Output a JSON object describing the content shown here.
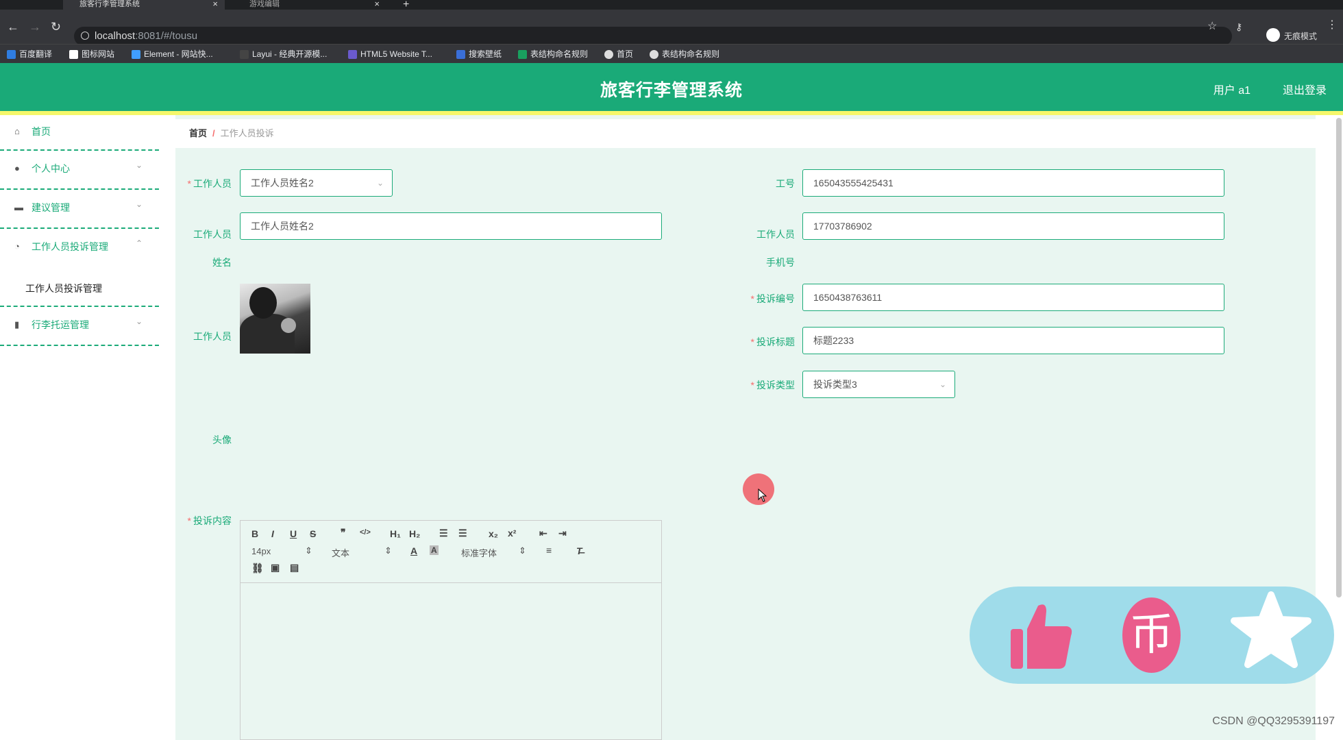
{
  "browser": {
    "tabs": [
      {
        "title": "旅客行李管理系统",
        "active": true
      },
      {
        "title": "游戏编辑",
        "active": false
      }
    ],
    "url_host": "localhost",
    "url_rest": ":8081/#/tousu",
    "profile_label": "无痕模式",
    "bookmarks": [
      "百度翻译",
      "图标网站",
      "Element - 网站快...",
      "Layui - 经典开源模...",
      "HTML5 Website T...",
      "搜索壁纸",
      "表结构命名规则",
      "首页",
      "表结构命名规则"
    ]
  },
  "header": {
    "title": "旅客行李管理系统",
    "user": "用户 a1",
    "logout": "退出登录"
  },
  "sidebar": {
    "items": [
      {
        "label": "首页",
        "icon": "home-icon"
      },
      {
        "label": "个人中心",
        "icon": "user-icon"
      },
      {
        "label": "建议管理",
        "icon": "ticket-icon"
      },
      {
        "label": "工作人员投诉管理",
        "icon": "compass-icon",
        "expanded": true
      },
      {
        "label": "行李托运管理",
        "icon": "bars-icon"
      }
    ],
    "submenu": "工作人员投诉管理"
  },
  "breadcrumb": {
    "home": "首页",
    "separator": "/",
    "current": "工作人员投诉"
  },
  "form": {
    "staff_label": "工作人员",
    "staff_value": "工作人员姓名2",
    "job_no_label": "工号",
    "job_no_value": "165043555425431",
    "staff_name_label_1": "工作人员",
    "staff_name_label_2": "姓名",
    "staff_name_value": "工作人员姓名2",
    "staff_phone_label_1": "工作人员",
    "staff_phone_label_2": "手机号",
    "staff_phone_value": "17703786902",
    "avatar_label_1": "工作人员",
    "avatar_label_2": "头像",
    "complaint_no_label": "投诉编号",
    "complaint_no_value": "1650438763611",
    "complaint_title_label": "投诉标题",
    "complaint_title_value": "标题2233",
    "complaint_type_label": "投诉类型",
    "complaint_type_value": "投诉类型3",
    "content_label": "投诉内容",
    "editor": {
      "font_size": "14px",
      "block_format": "文本",
      "font_family": "标准字体"
    }
  },
  "watermark": "CSDN @QQ3295391197",
  "colors": {
    "primary": "#1aaa78",
    "required": "#f56c6c",
    "header_underline": "#f5f76a"
  }
}
